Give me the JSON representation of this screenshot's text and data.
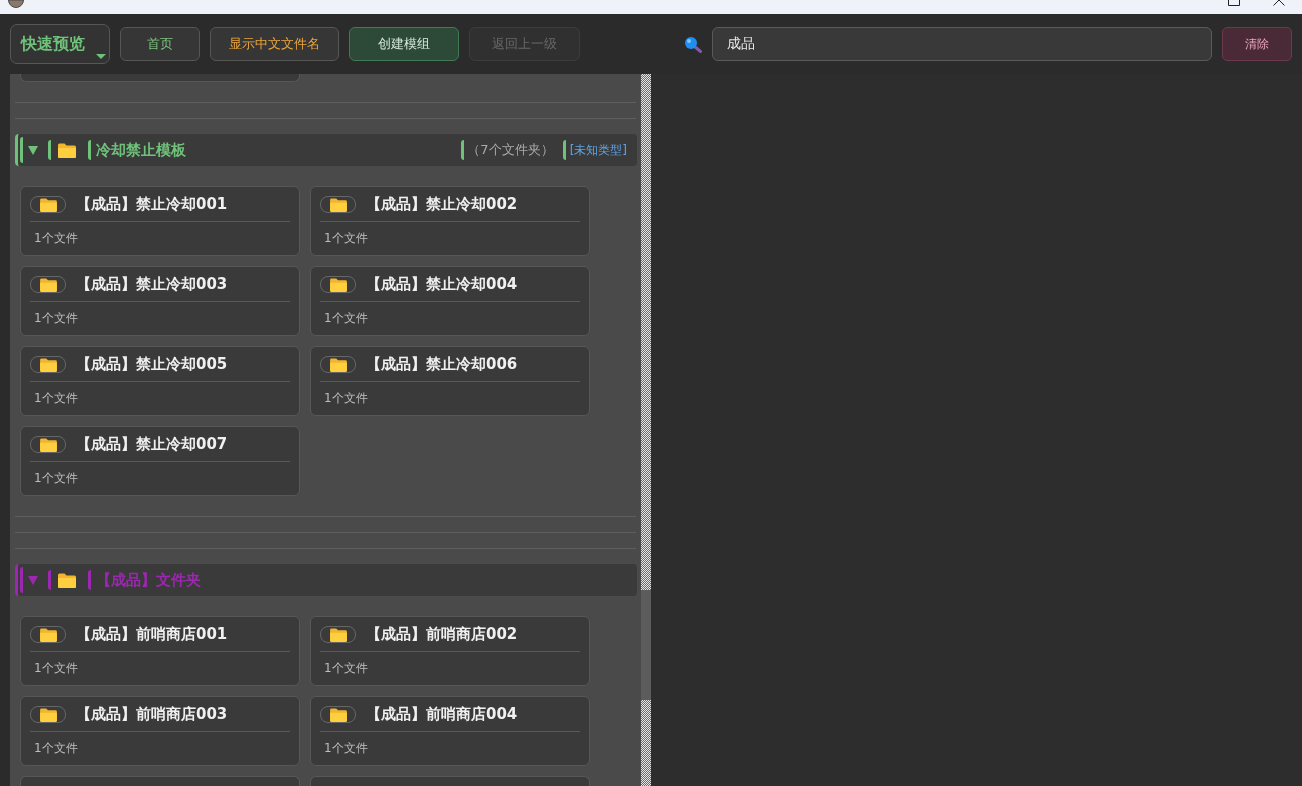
{
  "toolbar": {
    "mode_dropdown": {
      "label": "快速预览"
    },
    "buttons": [
      {
        "label": "首页",
        "kind": "nav",
        "disabled": false
      },
      {
        "label": "显示中文文件名",
        "kind": "option",
        "disabled": false
      },
      {
        "label": "创建模组",
        "kind": "primary",
        "disabled": false
      },
      {
        "label": "返回上一级",
        "kind": "nav",
        "disabled": true
      }
    ],
    "search": {
      "value": "成品"
    },
    "clear_button": {
      "label": "清除"
    }
  },
  "folder_list": {
    "card_cut_off_above": true,
    "sections": [
      {
        "title": "冷却禁止模板",
        "color": "#6fc27a",
        "expanded": true,
        "count": "（7个文件夹）",
        "type_tag": "[未知类型]",
        "cards": [
          {
            "title": "【成品】禁止冷却001",
            "meta": "1个文件"
          },
          {
            "title": "【成品】禁止冷却002",
            "meta": "1个文件"
          },
          {
            "title": "【成品】禁止冷却003",
            "meta": "1个文件"
          },
          {
            "title": "【成品】禁止冷却004",
            "meta": "1个文件"
          },
          {
            "title": "【成品】禁止冷却005",
            "meta": "1个文件"
          },
          {
            "title": "【成品】禁止冷却006",
            "meta": "1个文件"
          },
          {
            "title": "【成品】禁止冷却007",
            "meta": "1个文件"
          }
        ]
      },
      {
        "title": "【成品】文件夹",
        "color": "#9c27b0",
        "expanded": true,
        "more_cards_below": true,
        "cards": [
          {
            "title": "【成品】前哨商店001",
            "meta": "1个文件"
          },
          {
            "title": "【成品】前哨商店002",
            "meta": "1个文件"
          },
          {
            "title": "【成品】前哨商店003",
            "meta": "1个文件"
          },
          {
            "title": "【成品】前哨商店004",
            "meta": "1个文件"
          }
        ]
      }
    ]
  }
}
